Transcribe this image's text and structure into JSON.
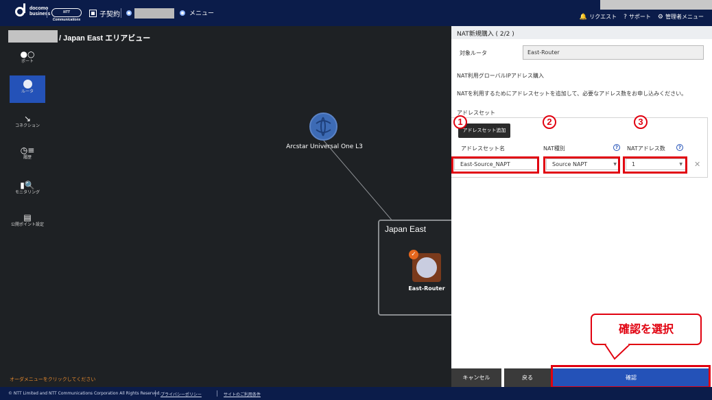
{
  "header": {
    "logo_line1": "docomo",
    "logo_line2": "business",
    "partner_logo": "NTT Communications",
    "contract_label": "子契約",
    "menu_label": "メニュー",
    "right_items": [
      {
        "icon": "bell-icon",
        "label": "リクエスト"
      },
      {
        "icon": "help-circle-icon",
        "label": "サポート"
      },
      {
        "icon": "gear-icon",
        "label": "管理者メニュー"
      }
    ]
  },
  "breadcrumb": {
    "text": "/ Japan East エリアビュー"
  },
  "sidebar": {
    "items": [
      {
        "icon": "port-icon",
        "label": "ポート"
      },
      {
        "icon": "router-icon",
        "label": "ルータ",
        "active": true
      },
      {
        "icon": "connection-icon",
        "label": "コネクション"
      },
      {
        "icon": "history-icon",
        "label": "履歴"
      },
      {
        "icon": "monitoring-icon",
        "label": "モニタリング"
      },
      {
        "icon": "public-point-icon",
        "label": "公開ポイント設定"
      }
    ]
  },
  "map": {
    "global_node_label": "Arcstar Universal One L3",
    "region_label": "Japan East",
    "router_label": "East-Router",
    "order_message": "オーダメニューをクリックしてください"
  },
  "panel": {
    "title": "NAT新規購入 ( 2/2 )",
    "router_label": "対象ルータ",
    "router_value": "East-Router",
    "purchase_text": "NAT利用グローバルIPアドレス購入",
    "description": "NATを利用するためにアドレスセットを追加して、必要なアドレス数をお申し込みください。",
    "address_set_label": "アドレスセット",
    "add_button": "アドレスセット追加",
    "columns": {
      "name": "アドレスセット名",
      "type": "NAT種別",
      "count": "NATアドレス数"
    },
    "row": {
      "name": "East-Source_NAPT",
      "type": "Source NAPT",
      "count": "1"
    },
    "markers": [
      "1",
      "2",
      "3"
    ]
  },
  "annotation": {
    "callout": "確認を選択"
  },
  "buttons": {
    "cancel": "キャンセル",
    "back": "戻る",
    "confirm": "確認"
  },
  "footer": {
    "copyright": "© NTT Limited and NTT Communications Corporation All Rights Reserved.",
    "privacy": "プライバシーポリシー",
    "terms": "サイトのご利用条件"
  },
  "colors": {
    "header_bg": "#0b1c4a",
    "accent": "#2452b8",
    "annotation_red": "#e1000f",
    "warning_orange": "#e78a2e"
  }
}
